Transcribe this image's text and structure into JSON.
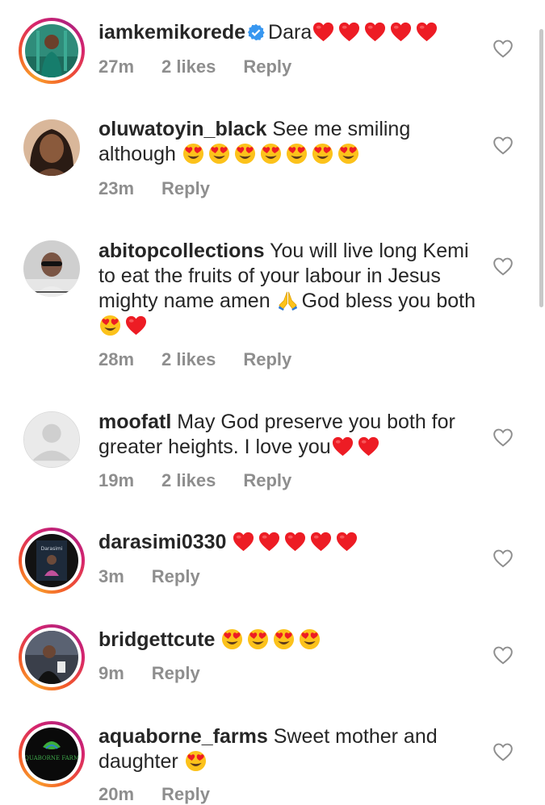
{
  "comments": [
    {
      "username": "iamkemikorede",
      "verified": true,
      "text": "Dara",
      "emojis": [
        "red-heart",
        "red-heart",
        "red-heart",
        "red-heart",
        "red-heart"
      ],
      "time": "27m",
      "likes": "2 likes",
      "reply": "Reply",
      "avatar": "story-woman-teal"
    },
    {
      "username": "oluwatoyin_black",
      "verified": false,
      "text": "See me smiling although",
      "emojis": [
        "heart-eyes",
        "heart-eyes",
        "heart-eyes",
        "heart-eyes",
        "heart-eyes",
        "heart-eyes",
        "heart-eyes"
      ],
      "time": "23m",
      "likes": "",
      "reply": "Reply",
      "avatar": "woman-portrait"
    },
    {
      "username": "abitopcollections",
      "verified": false,
      "text1": "You will live long Kemi to eat the fruits of your labour in Jesus mighty name amen",
      "text2": "God bless you both",
      "emojis_mid": [
        "praying-hands"
      ],
      "emojis": [
        "heart-eyes",
        "red-heart"
      ],
      "time": "28m",
      "likes": "2 likes",
      "reply": "Reply",
      "avatar": "woman-sunglasses"
    },
    {
      "username": "moofatl",
      "verified": false,
      "text": "May God preserve you both for greater heights. I love you",
      "emojis": [
        "red-heart",
        "red-heart"
      ],
      "time": "19m",
      "likes": "2 likes",
      "reply": "Reply",
      "avatar": "default-avatar"
    },
    {
      "username": "darasimi0330",
      "verified": false,
      "text": "",
      "emojis": [
        "red-heart",
        "red-heart",
        "red-heart",
        "red-heart",
        "red-heart"
      ],
      "time": "3m",
      "likes": "",
      "reply": "Reply",
      "avatar": "story-dark-poster"
    },
    {
      "username": "bridgettcute",
      "verified": false,
      "text": "",
      "emojis": [
        "heart-eyes",
        "heart-eyes",
        "heart-eyes",
        "heart-eyes"
      ],
      "time": "9m",
      "likes": "",
      "reply": "Reply",
      "avatar": "story-woman-dark"
    },
    {
      "username": "aquaborne_farms",
      "verified": false,
      "text": "Sweet mother and daughter",
      "emojis": [
        "heart-eyes"
      ],
      "time": "20m",
      "likes": "",
      "reply": "Reply",
      "avatar": "aquaborne-logo",
      "logo_text": "AQUABORNE FARMS"
    }
  ],
  "colors": {
    "heart": "#ed1c24",
    "face": "#fcc21b",
    "verified": "#3897f0",
    "muted": "#8e8e8e",
    "text": "#262626"
  },
  "icons": {
    "like": "heart-outline-icon",
    "verified": "verified-badge-icon"
  }
}
